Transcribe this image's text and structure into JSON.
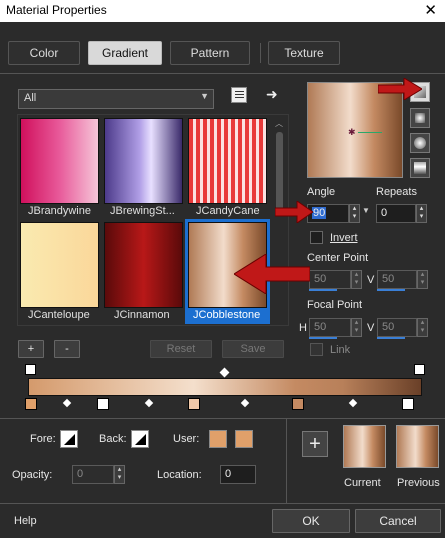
{
  "window": {
    "title": "Material Properties",
    "close_glyph": "✕"
  },
  "tabs": [
    {
      "label": "Color"
    },
    {
      "label": "Gradient"
    },
    {
      "label": "Pattern"
    },
    {
      "label": "Texture"
    }
  ],
  "category": {
    "selected": "All"
  },
  "gradients": [
    {
      "name": "JBrandywine"
    },
    {
      "name": "JBrewingSt..."
    },
    {
      "name": "JCandyCane"
    },
    {
      "name": "JCanteloupe"
    },
    {
      "name": "JCinnamon"
    },
    {
      "name": "JCobblestone"
    }
  ],
  "list_buttons": {
    "add": "+",
    "remove": "-",
    "reset": "Reset",
    "save": "Save"
  },
  "angle": {
    "label": "Angle",
    "value": "90"
  },
  "repeats": {
    "label": "Repeats",
    "value": "0"
  },
  "invert": {
    "label": "Invert",
    "checked": false
  },
  "center_point": {
    "label": "Center Point",
    "h_value": "50",
    "v_label": "V",
    "v_value": "50"
  },
  "focal_point": {
    "label": "Focal Point",
    "h_label": "H",
    "h_value": "50",
    "v_label": "V",
    "v_value": "50",
    "link_label": "Link"
  },
  "stops": {
    "fore_label": "Fore:",
    "back_label": "Back:",
    "user_label": "User:",
    "opacity_label": "Opacity:",
    "opacity_value": "0",
    "location_label": "Location:",
    "location_value": "0"
  },
  "preview": {
    "current_label": "Current",
    "previous_label": "Previous"
  },
  "footer": {
    "help": "Help",
    "ok": "OK",
    "cancel": "Cancel"
  },
  "colors": {
    "accent": "#3a7fd6",
    "user_color": "#e0a06a",
    "arrow_red": "#c01818"
  }
}
